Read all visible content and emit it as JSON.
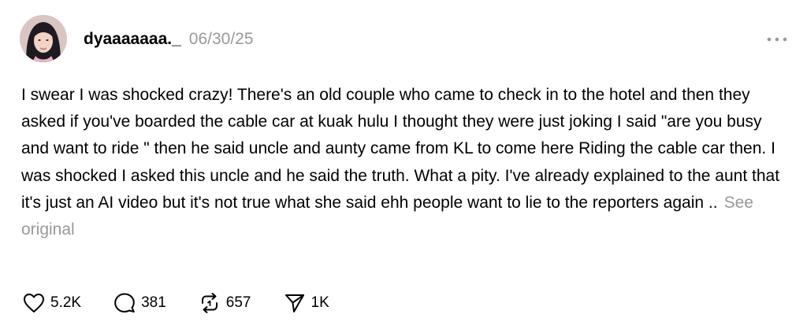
{
  "post": {
    "username": "dyaaaaaaa._",
    "date": "06/30/25",
    "body": "I swear I was shocked crazy! There's an old couple who came to check in to the hotel and then they asked if you've boarded the cable car at kuak hulu I thought they were just joking I said \"are you busy and want to ride \" then he said uncle and aunty came from KL to come here Riding the cable car then. I was shocked I asked this uncle and he said the truth. What a pity. I've already explained to the aunt that it's just an AI video but it's not true what she said ehh people want to lie to the reporters again ..",
    "see_original": "See original",
    "more_icon": "more-horizontal-icon"
  },
  "actions": {
    "like": {
      "icon": "heart-icon",
      "count": "5.2K"
    },
    "reply": {
      "icon": "comment-icon",
      "count": "381"
    },
    "repost": {
      "icon": "repost-icon",
      "count": "657"
    },
    "share": {
      "icon": "send-icon",
      "count": "1K"
    }
  },
  "colors": {
    "text": "#000000",
    "muted": "#999999",
    "background": "#ffffff"
  }
}
